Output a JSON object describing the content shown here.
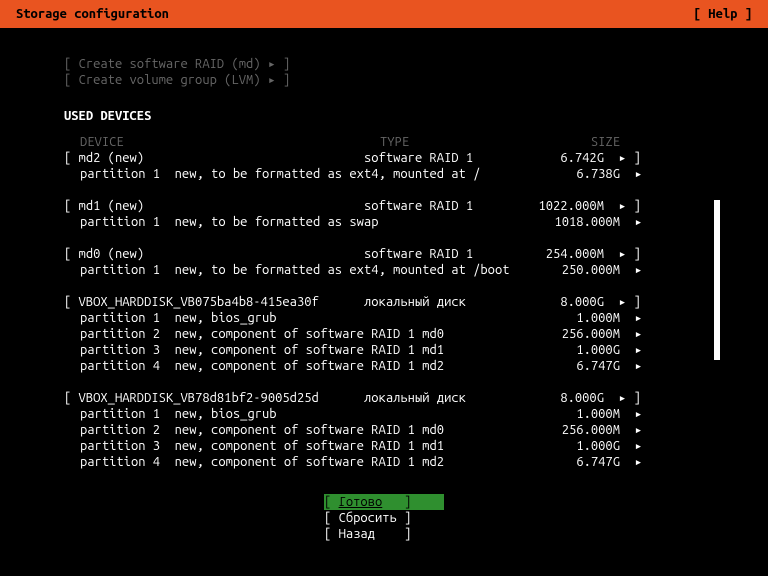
{
  "header": {
    "title": "Storage configuration",
    "help": "[ Help ]"
  },
  "menu": {
    "raid": "Create software RAID (md) ▸",
    "lvm": "Create volume group (LVM) ▸"
  },
  "section": "USED DEVICES",
  "cols": {
    "device": "DEVICE",
    "type": "TYPE",
    "size": "SIZE"
  },
  "devices": [
    {
      "name": "md2 (new)",
      "type": "software RAID 1",
      "size": "6.742G",
      "parts": [
        {
          "name": "partition 1",
          "desc": "new, to be formatted as ext4, mounted at /",
          "size": "6.738G"
        }
      ]
    },
    {
      "name": "md1 (new)",
      "type": "software RAID 1",
      "size": "1022.000M",
      "parts": [
        {
          "name": "partition 1",
          "desc": "new, to be formatted as swap",
          "size": "1018.000M"
        }
      ]
    },
    {
      "name": "md0 (new)",
      "type": "software RAID 1",
      "size": "254.000M",
      "parts": [
        {
          "name": "partition 1",
          "desc": "new, to be formatted as ext4, mounted at /boot",
          "size": "250.000M"
        }
      ]
    },
    {
      "name": "VBOX_HARDDISK_VB075ba4b8-415ea30f",
      "type": "локальный диск",
      "size": "8.000G",
      "parts": [
        {
          "name": "partition 1",
          "desc": "new, bios_grub",
          "size": "1.000M"
        },
        {
          "name": "partition 2",
          "desc": "new, component of software RAID 1 md0",
          "size": "256.000M"
        },
        {
          "name": "partition 3",
          "desc": "new, component of software RAID 1 md1",
          "size": "1.000G"
        },
        {
          "name": "partition 4",
          "desc": "new, component of software RAID 1 md2",
          "size": "6.747G"
        }
      ]
    },
    {
      "name": "VBOX_HARDDISK_VB78d81bf2-9005d25d",
      "type": "локальный диск",
      "size": "8.000G",
      "parts": [
        {
          "name": "partition 1",
          "desc": "new, bios_grub",
          "size": "1.000M"
        },
        {
          "name": "partition 2",
          "desc": "new, component of software RAID 1 md0",
          "size": "256.000M"
        },
        {
          "name": "partition 3",
          "desc": "new, component of software RAID 1 md1",
          "size": "1.000G"
        },
        {
          "name": "partition 4",
          "desc": "new, component of software RAID 1 md2",
          "size": "6.747G"
        }
      ]
    }
  ],
  "buttons": {
    "done": "Готово",
    "reset": "Сбросить",
    "back": "Назад"
  }
}
